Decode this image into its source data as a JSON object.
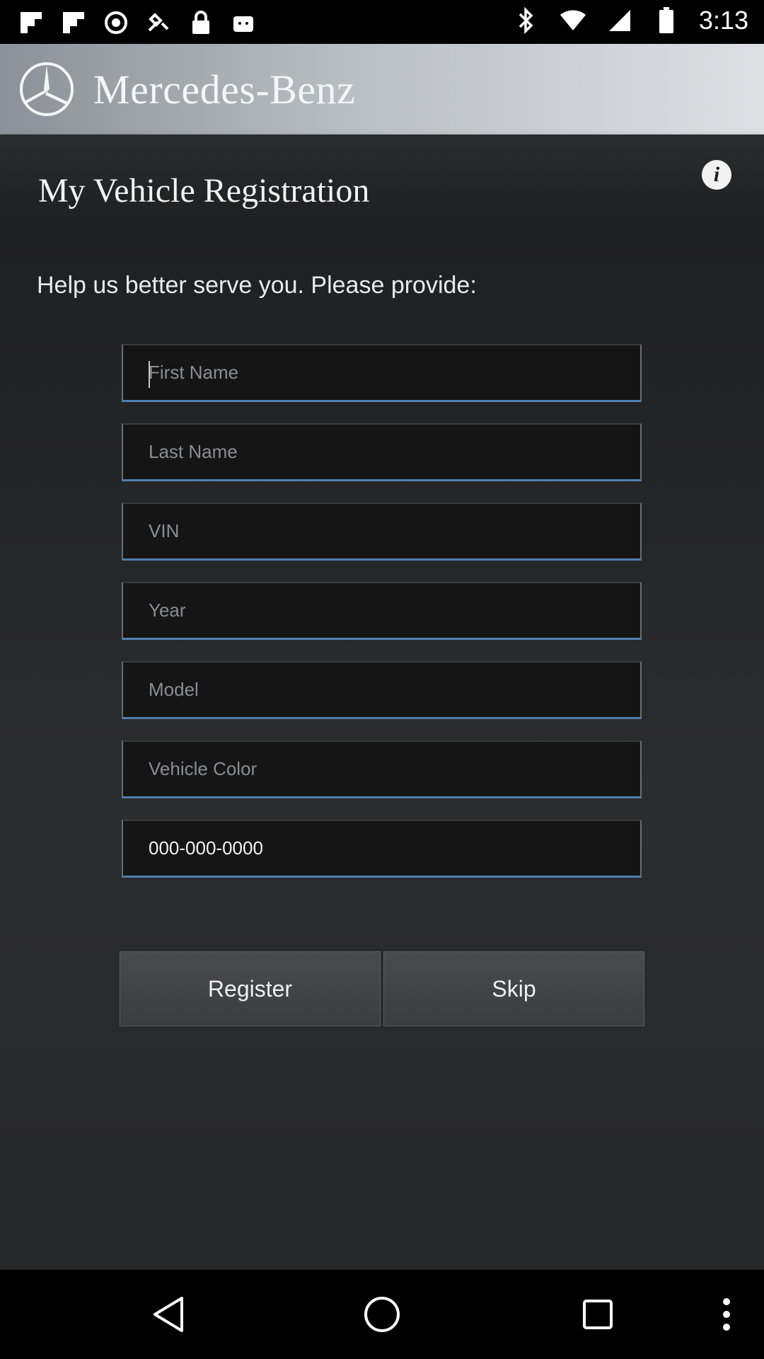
{
  "status_bar": {
    "time": "3:13",
    "icons_left": [
      "flipboard-icon",
      "flipboard-icon",
      "sync-icon",
      "fake-gps-icon",
      "lock-icon",
      "android-icon"
    ],
    "icons_right": [
      "bluetooth-icon",
      "wifi-icon",
      "signal-icon",
      "battery-icon"
    ]
  },
  "brand": {
    "name": "Mercedes-Benz",
    "logo_icon": "mercedes-star-icon"
  },
  "header": {
    "title": "My Vehicle Registration",
    "info_icon": "info-icon",
    "info_glyph": "i"
  },
  "form": {
    "subtitle": "Help us better serve you. Please provide:",
    "fields": {
      "first_name": {
        "placeholder": "First Name",
        "value": ""
      },
      "last_name": {
        "placeholder": "Last Name",
        "value": ""
      },
      "vin": {
        "placeholder": "VIN",
        "value": ""
      },
      "year": {
        "placeholder": "Year",
        "value": ""
      },
      "model": {
        "placeholder": "Model",
        "value": ""
      },
      "vehicle_color": {
        "placeholder": "Vehicle Color",
        "value": ""
      },
      "phone": {
        "placeholder": "",
        "value": "000-000-0000"
      }
    }
  },
  "actions": {
    "register_label": "Register",
    "skip_label": "Skip"
  },
  "nav": {
    "back_icon": "back-icon",
    "home_icon": "home-icon",
    "recents_icon": "recents-icon",
    "menu_icon": "overflow-menu-icon"
  },
  "colors": {
    "field_underline": "#4f7fb0",
    "background": "#1f2022",
    "brand_bar": "#b9bec4"
  }
}
